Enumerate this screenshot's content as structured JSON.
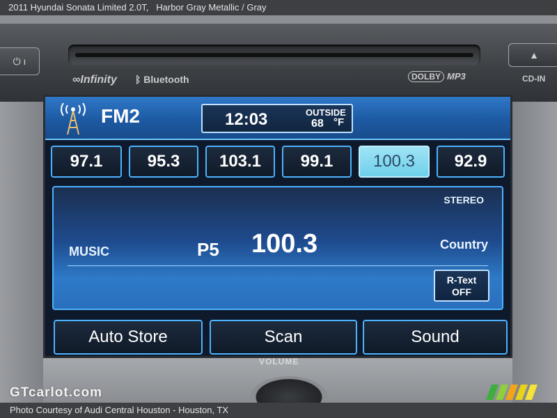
{
  "caption": {
    "title": "2011 Hyundai Sonata Limited 2.0T,",
    "color": "Harbor Gray Metallic",
    "separator": "/",
    "interior": "Gray"
  },
  "bezel": {
    "left_button": "⏻ ı",
    "eject_label": "▲",
    "brand_infinity": "∞Infinity",
    "brand_bluetooth": "ᛒ Bluetooth",
    "brand_dolby": "DOLBY",
    "brand_mp3": "MP3",
    "cd_in": "CD-IN",
    "volume_label": "VOLUME"
  },
  "screen": {
    "band": "FM2",
    "clock": "12:03",
    "outside_label": "OUTSIDE",
    "outside_temp": "68",
    "temp_unit": "°F",
    "presets": [
      {
        "label": "97.1",
        "active": false
      },
      {
        "label": "95.3",
        "active": false
      },
      {
        "label": "103.1",
        "active": false
      },
      {
        "label": "99.1",
        "active": false
      },
      {
        "label": "100.3",
        "active": true
      },
      {
        "label": "92.9",
        "active": false
      }
    ],
    "stereo": "STEREO",
    "program_type": "MUSIC",
    "preset_number": "P5",
    "frequency": "100.3",
    "genre": "Country",
    "rtext_line1": "R-Text",
    "rtext_line2": "OFF",
    "actions": [
      "Auto Store",
      "Scan",
      "Sound"
    ]
  },
  "watermark": "GTcarlot.com",
  "footer": "Photo Courtesy of Audi Central Houston - Houston, TX",
  "colors": {
    "screen_accent": "#4db3ff",
    "active_preset": "#8fdcf0",
    "header_blue": "#1d5aa3"
  }
}
